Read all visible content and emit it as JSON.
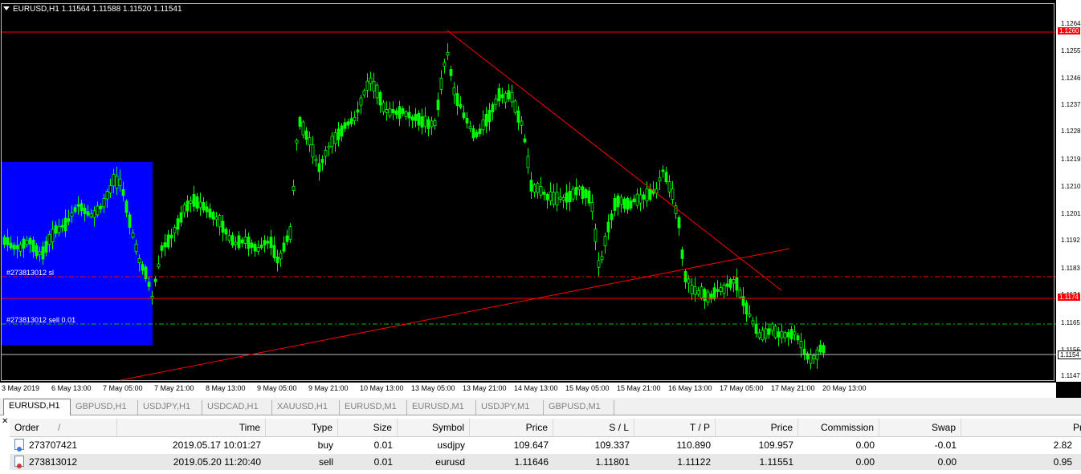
{
  "chart": {
    "title": "EURUSD,H1  1.11564 1.11588 1.11520 1.11541",
    "colors": {
      "background": "#000000",
      "candles": "#00ff00",
      "lines": "#ff0000",
      "selection": "#0000ff",
      "grid": "#c0c0c0"
    },
    "price_ticks": [
      "1.1264",
      "1.1255",
      "1.1246",
      "1.1237",
      "1.1228",
      "1.1219",
      "1.1210",
      "1.1201",
      "1.1192",
      "1.1183",
      "1.1174",
      "1.1165",
      "1.1156",
      "1.1147"
    ],
    "price_tags": [
      "1.1260",
      "1.1174",
      "1.1154"
    ],
    "time_ticks": [
      "3 May 2019",
      "6 May 13:00",
      "7 May 05:00",
      "7 May 21:00",
      "8 May 13:00",
      "9 May 05:00",
      "9 May 21:00",
      "10 May 13:00",
      "13 May 05:00",
      "13 May 21:00",
      "14 May 13:00",
      "15 May 05:00",
      "15 May 21:00",
      "16 May 13:00",
      "17 May 05:00",
      "17 May 21:00",
      "20 May 13:00"
    ],
    "order_labels": {
      "sl": "#273813012 sl",
      "sell": "#273813012 sell 0.01"
    }
  },
  "tabs": [
    "EURUSD,H1",
    "GBPUSD,H1",
    "USDJPY,H1",
    "USDCAD,H1",
    "XAUUSD,H1",
    "EURUSD,M1",
    "EURUSD,M1",
    "USDJPY,M1",
    "GBPUSD,M1"
  ],
  "terminal": {
    "columns": [
      "Order",
      "Time",
      "Type",
      "Size",
      "Symbol",
      "Price",
      "S / L",
      "T / P",
      "Price",
      "Commission",
      "Swap",
      "Profit"
    ],
    "sort_indicator": "/",
    "rows": [
      {
        "order": "273707421",
        "time": "2019.05.17 10:01:27",
        "type": "buy",
        "size": "0.01",
        "symbol": "usdjpy",
        "price": "109.647",
        "sl": "109.337",
        "tp": "110.890",
        "cur_price": "109.957",
        "commission": "0.00",
        "swap": "-0.01",
        "profit": "2.82"
      },
      {
        "order": "273813012",
        "time": "2019.05.20 11:20:40",
        "type": "sell",
        "size": "0.01",
        "symbol": "eurusd",
        "price": "1.11646",
        "sl": "1.11801",
        "tp": "1.11122",
        "cur_price": "1.11551",
        "commission": "0.00",
        "swap": "0.00",
        "profit": "0.95"
      }
    ]
  }
}
